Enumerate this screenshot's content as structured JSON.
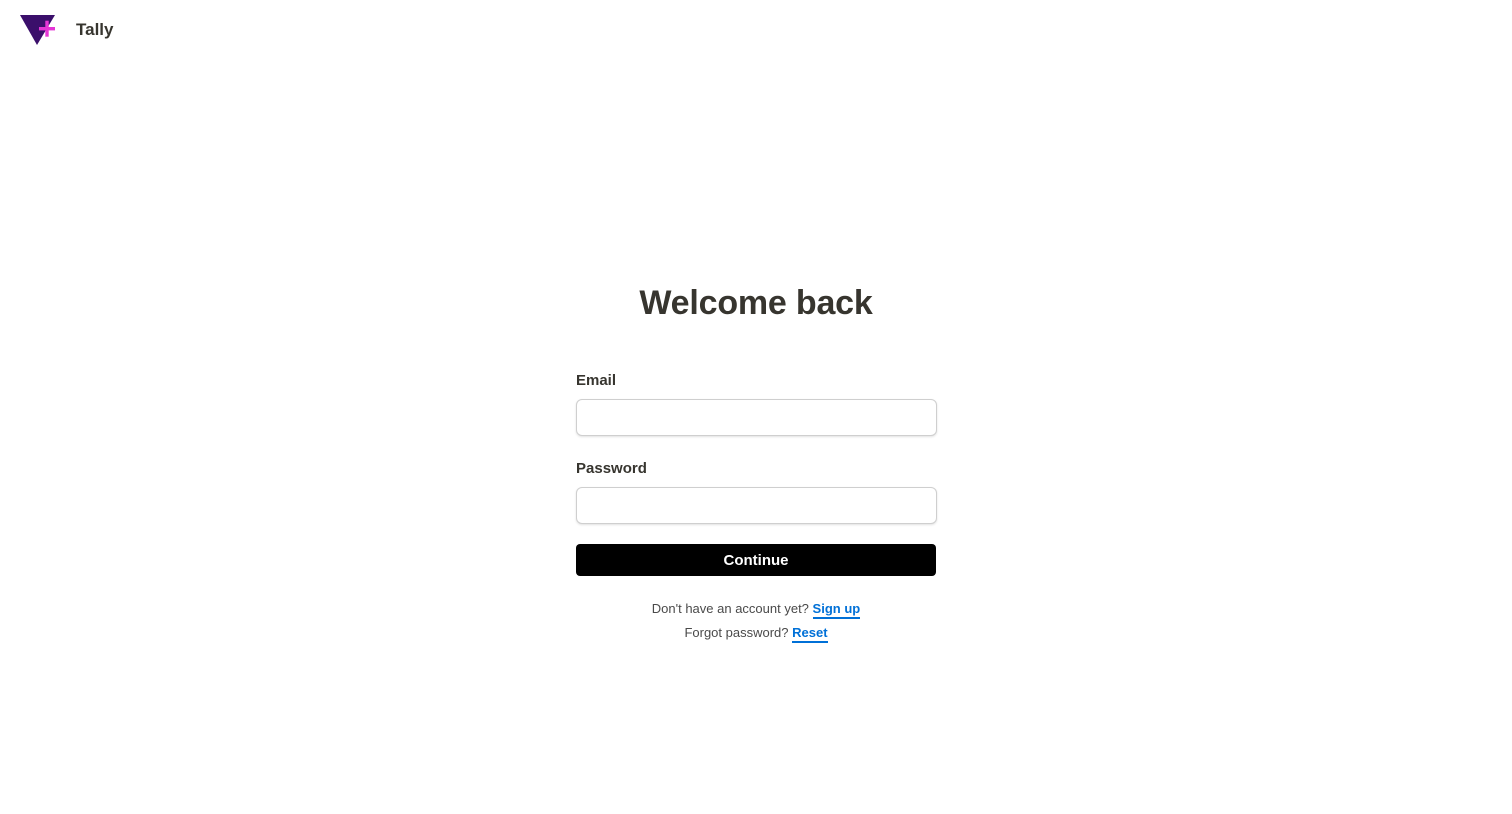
{
  "header": {
    "logo_icon": "tally-logo-icon",
    "brand_name": "Tally"
  },
  "login": {
    "title": "Welcome back",
    "email_label": "Email",
    "email_value": "",
    "email_placeholder": "",
    "password_label": "Password",
    "password_value": "",
    "password_placeholder": "",
    "continue_label": "Continue"
  },
  "footer": {
    "signup_prompt": "Don't have an account yet?",
    "signup_link": "Sign up",
    "forgot_prompt": "Forgot password?",
    "reset_link": "Reset"
  },
  "colors": {
    "text": "#37352f",
    "link": "#0070d7",
    "button_bg": "#000000",
    "logo_purple": "#3b0f6b",
    "logo_pink": "#e535d6"
  }
}
